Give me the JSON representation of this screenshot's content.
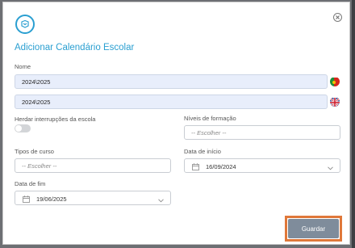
{
  "dialog": {
    "title": "Adicionar Calendário Escolar",
    "name_label": "Nome",
    "name_pt_value": "2024\\2025",
    "name_en_value": "2024\\2025",
    "inherit_label": "Herdar interrupções da escola",
    "levels_label": "Níveis de formação",
    "levels_placeholder": "-- Escolher --",
    "course_types_label": "Tipos de curso",
    "course_types_placeholder": "-- Escolher --",
    "start_date_label": "Data de início",
    "start_date_value": "16/09/2024",
    "end_date_label": "Data de fim",
    "end_date_value": "19/06/2025",
    "save_label": "Guardar"
  },
  "colors": {
    "accent": "#2a9fd1",
    "save_button": "#7f8c9b",
    "highlight": "#e0783a"
  }
}
